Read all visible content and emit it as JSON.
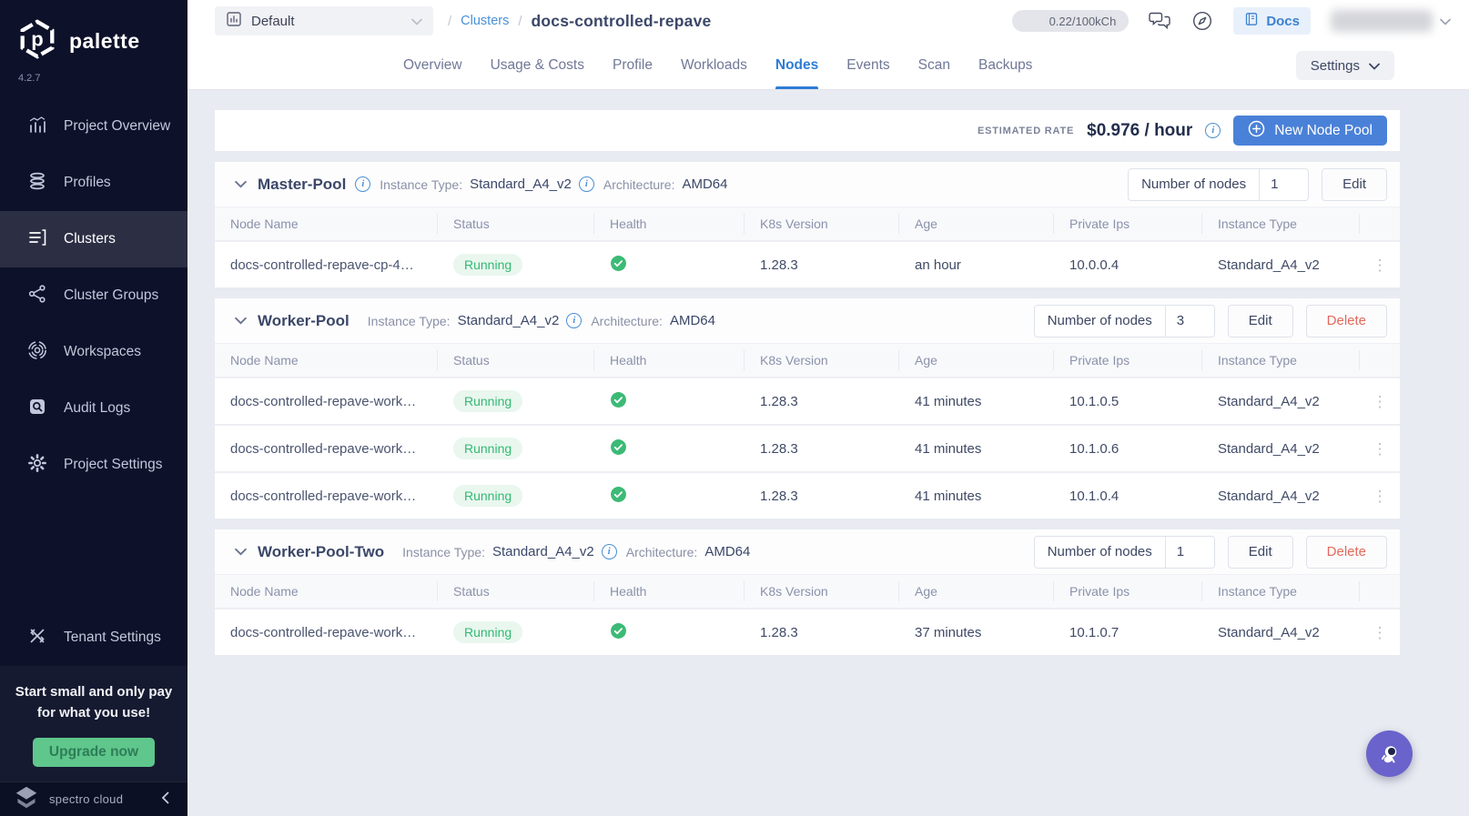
{
  "brand": {
    "name": "palette",
    "version": "4.2.7",
    "footer_name": "spectro cloud"
  },
  "icons": {
    "kebab": "⋮",
    "info": "i"
  },
  "header": {
    "project_selector": "Default",
    "breadcrumb": {
      "separator": "/",
      "section": "Clusters",
      "current": "docs-controlled-repave"
    },
    "usage_badge": "0.22/100kCh",
    "docs_label": "Docs"
  },
  "tabs": [
    {
      "label": "Overview"
    },
    {
      "label": "Usage & Costs"
    },
    {
      "label": "Profile"
    },
    {
      "label": "Workloads"
    },
    {
      "label": "Nodes",
      "active": true
    },
    {
      "label": "Events"
    },
    {
      "label": "Scan"
    },
    {
      "label": "Backups"
    }
  ],
  "settings_button": "Settings",
  "toolbar": {
    "estimated_rate_label": "ESTIMATED RATE",
    "rate_value": "$0.976 / hour",
    "new_node_pool_label": "New Node Pool"
  },
  "table": {
    "headers": [
      "Node Name",
      "Status",
      "Health",
      "K8s Version",
      "Age",
      "Private Ips",
      "Instance Type"
    ]
  },
  "labels": {
    "instance_type": "Instance Type:",
    "architecture": "Architecture:",
    "number_of_nodes": "Number of nodes",
    "edit": "Edit",
    "delete": "Delete"
  },
  "pools": [
    {
      "name": "Master-Pool",
      "instance_type": "Standard_A4_v2",
      "architecture": "AMD64",
      "nodes_count": "1",
      "rows": [
        {
          "name": "docs-controlled-repave-cp-4…",
          "status": "Running",
          "k8s": "1.28.3",
          "age": "an hour",
          "ip": "10.0.0.4",
          "instance": "Standard_A4_v2"
        }
      ]
    },
    {
      "name": "Worker-Pool",
      "instance_type": "Standard_A4_v2",
      "architecture": "AMD64",
      "nodes_count": "3",
      "rows": [
        {
          "name": "docs-controlled-repave-work…",
          "status": "Running",
          "k8s": "1.28.3",
          "age": "41 minutes",
          "ip": "10.1.0.5",
          "instance": "Standard_A4_v2"
        },
        {
          "name": "docs-controlled-repave-work…",
          "status": "Running",
          "k8s": "1.28.3",
          "age": "41 minutes",
          "ip": "10.1.0.6",
          "instance": "Standard_A4_v2"
        },
        {
          "name": "docs-controlled-repave-work…",
          "status": "Running",
          "k8s": "1.28.3",
          "age": "41 minutes",
          "ip": "10.1.0.4",
          "instance": "Standard_A4_v2"
        }
      ]
    },
    {
      "name": "Worker-Pool-Two",
      "instance_type": "Standard_A4_v2",
      "architecture": "AMD64",
      "nodes_count": "1",
      "rows": [
        {
          "name": "docs-controlled-repave-work…",
          "status": "Running",
          "k8s": "1.28.3",
          "age": "37 minutes",
          "ip": "10.1.0.7",
          "instance": "Standard_A4_v2"
        }
      ]
    }
  ],
  "sidebar": {
    "items": [
      {
        "label": "Project Overview"
      },
      {
        "label": "Profiles"
      },
      {
        "label": "Clusters",
        "active": true
      },
      {
        "label": "Cluster Groups"
      },
      {
        "label": "Workspaces"
      },
      {
        "label": "Audit Logs"
      },
      {
        "label": "Project Settings"
      },
      {
        "label": "Tenant Settings"
      }
    ],
    "upsell_line1": "Start small and only pay",
    "upsell_line2": "for what you use!",
    "upgrade_label": "Upgrade now"
  },
  "colors": {
    "sidebar_bg": "#0d1129",
    "accent_blue": "#2e7cd6",
    "button_blue": "#4a81d8",
    "success_green": "#3cba76",
    "danger_red": "#e2695c",
    "upgrade_green": "#5fc68c",
    "fab_purple": "#6a63cb"
  }
}
